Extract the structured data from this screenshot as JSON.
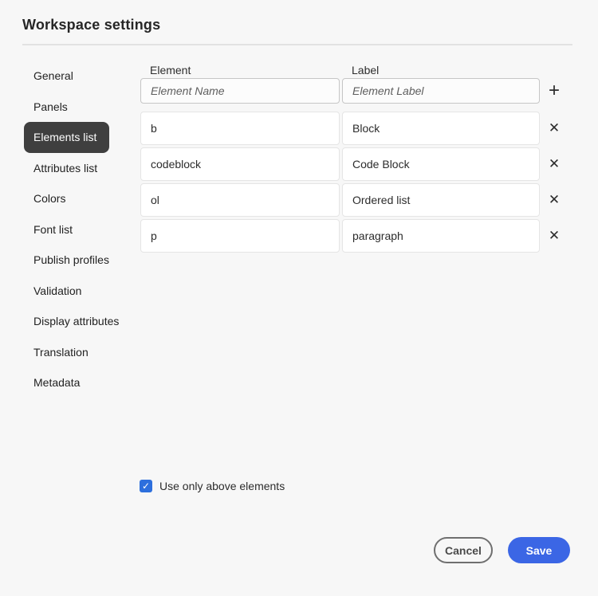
{
  "window": {
    "title": "Workspace settings"
  },
  "sidebar": {
    "items": [
      {
        "label": "General",
        "selected": false
      },
      {
        "label": "Panels",
        "selected": false
      },
      {
        "label": "Elements list",
        "selected": true
      },
      {
        "label": "Attributes list",
        "selected": false
      },
      {
        "label": "Colors",
        "selected": false
      },
      {
        "label": "Font list",
        "selected": false
      },
      {
        "label": "Publish profiles",
        "selected": false
      },
      {
        "label": "Validation",
        "selected": false
      },
      {
        "label": "Display attributes",
        "selected": false
      },
      {
        "label": "Translation",
        "selected": false
      },
      {
        "label": "Metadata",
        "selected": false
      }
    ]
  },
  "form": {
    "element_column_header": "Element",
    "label_column_header": "Label",
    "element_placeholder": "Element Name",
    "label_placeholder": "Element Label",
    "add_icon": "+",
    "remove_icon": "✕",
    "rows": [
      {
        "element": "b",
        "label": "Block"
      },
      {
        "element": "codeblock",
        "label": "Code Block"
      },
      {
        "element": "ol",
        "label": "Ordered list"
      },
      {
        "element": "p",
        "label": "paragraph"
      }
    ]
  },
  "options": {
    "use_only_above_label": "Use only above elements",
    "use_only_above_checked": true,
    "check_glyph": "✓"
  },
  "footer": {
    "cancel_label": "Cancel",
    "save_label": "Save"
  },
  "colors": {
    "accent": "#3b66e5",
    "checkbox": "#2d6fdd",
    "selected_tab_bg": "#3f3f3f",
    "page_bg": "#f7f7f7"
  }
}
